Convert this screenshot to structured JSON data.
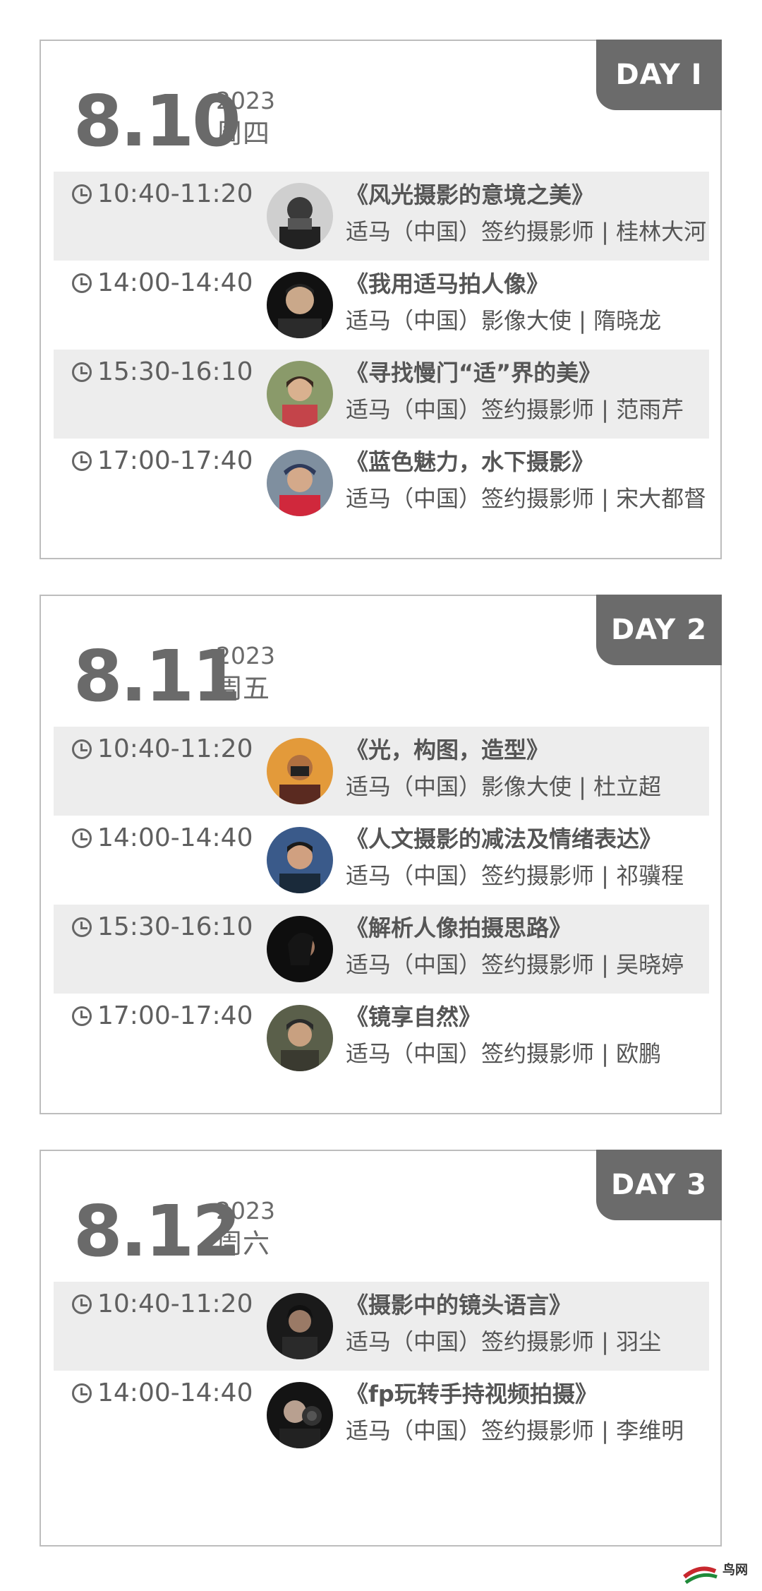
{
  "days": [
    {
      "badge": "DAY I",
      "date": "8.10",
      "year": "2023",
      "weekday": "周四",
      "sessions": [
        {
          "time": "10:40-11:20",
          "title": "《风光摄影的意境之美》",
          "speaker": "适马（中国）签约摄影师 | 桂林大河",
          "shaded": true
        },
        {
          "time": "14:00-14:40",
          "title": "《我用适马拍人像》",
          "speaker": "适马（中国）影像大使 | 隋晓龙",
          "shaded": false
        },
        {
          "time": "15:30-16:10",
          "title": "《寻找慢门“适”界的美》",
          "speaker": "适马（中国）签约摄影师 | 范雨芹",
          "shaded": true
        },
        {
          "time": "17:00-17:40",
          "title": "《蓝色魅力，水下摄影》",
          "speaker": "适马（中国）签约摄影师 | 宋大都督",
          "shaded": false
        }
      ]
    },
    {
      "badge": "DAY 2",
      "date": "8.11",
      "year": "2023",
      "weekday": "周五",
      "sessions": [
        {
          "time": "10:40-11:20",
          "title": "《光，构图，造型》",
          "speaker": "适马（中国）影像大使 | 杜立超",
          "shaded": true
        },
        {
          "time": "14:00-14:40",
          "title": "《人文摄影的减法及情绪表达》",
          "speaker": "适马（中国）签约摄影师 | 祁骥程",
          "shaded": false
        },
        {
          "time": "15:30-16:10",
          "title": "《解析人像拍摄思路》",
          "speaker": "适马（中国）签约摄影师 | 吴晓婷",
          "shaded": true
        },
        {
          "time": "17:00-17:40",
          "title": "《镜享自然》",
          "speaker": "适马（中国）签约摄影师 | 欧鹏",
          "shaded": false
        }
      ]
    },
    {
      "badge": "DAY 3",
      "date": "8.12",
      "year": "2023",
      "weekday": "周六",
      "sessions": [
        {
          "time": "10:40-11:20",
          "title": "《摄影中的镜头语言》",
          "speaker": "适马（中国）签约摄影师 | 羽尘",
          "shaded": true
        },
        {
          "time": "14:00-14:40",
          "title": "《fp玩转手持视频拍摄》",
          "speaker": "适马（中国）签约摄影师 | 李维明",
          "shaded": false
        }
      ]
    }
  ],
  "watermark": {
    "text": "鸟网"
  },
  "colors": {
    "badge": "#6b6b6b",
    "shade": "#ededed",
    "border": "#bdbdbd",
    "text": "#555555"
  }
}
